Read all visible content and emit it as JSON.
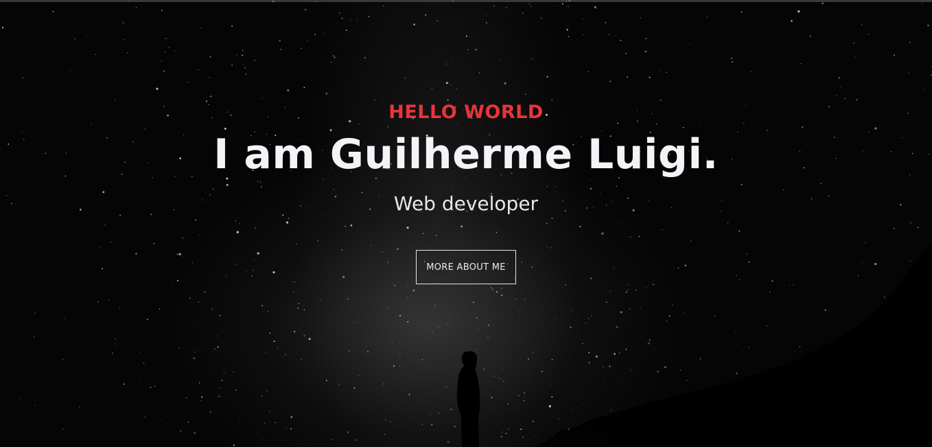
{
  "hero": {
    "eyebrow": "HELLO WORLD",
    "headline": "I am Guilherme Luigi.",
    "subtitle": "Web developer",
    "cta_label": "MORE ABOUT ME"
  },
  "colors": {
    "accent": "#e8353a",
    "text": "#f2f4f8",
    "background": "#050505"
  },
  "icons": [
    "starfield-background",
    "person-silhouette"
  ]
}
